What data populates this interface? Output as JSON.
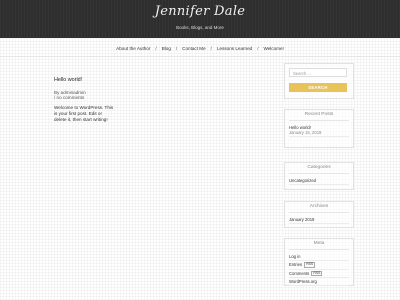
{
  "header": {
    "site_title": "Jennifer Dale",
    "site_description": "Books, Blogs, and More"
  },
  "nav": {
    "items": [
      {
        "label": "About the Author"
      },
      {
        "label": "Blog"
      },
      {
        "label": "Contact Me"
      },
      {
        "label": "Lessons Learned"
      },
      {
        "label": "Welcome!"
      }
    ],
    "separator": "/"
  },
  "post": {
    "title": "Hello world!",
    "meta_author": "By adminadmin",
    "meta_comments": "/ no comments",
    "body": "Welcome to WordPress. This is your first post. Edit or delete it, then start writing!"
  },
  "search": {
    "placeholder": "Search ...",
    "button_label": "SEARCH"
  },
  "recent_posts": {
    "title": "Recent Posts",
    "items": [
      {
        "title": "Hello world!",
        "date": "January 15, 2019"
      }
    ]
  },
  "categories": {
    "title": "Categories",
    "items": [
      {
        "label": "Uncategorized"
      }
    ]
  },
  "archives": {
    "title": "Archives",
    "items": [
      {
        "label": "January 2019"
      }
    ]
  },
  "meta": {
    "title": "Meta",
    "items": [
      {
        "label": "Log in",
        "rss": ""
      },
      {
        "label": "Entries",
        "rss": "RSS"
      },
      {
        "label": "Comments",
        "rss": "RSS"
      },
      {
        "label": "WordPress.org",
        "rss": ""
      }
    ]
  },
  "colors": {
    "header_bg": "#2e2e2e",
    "accent": "#e8c35a"
  }
}
